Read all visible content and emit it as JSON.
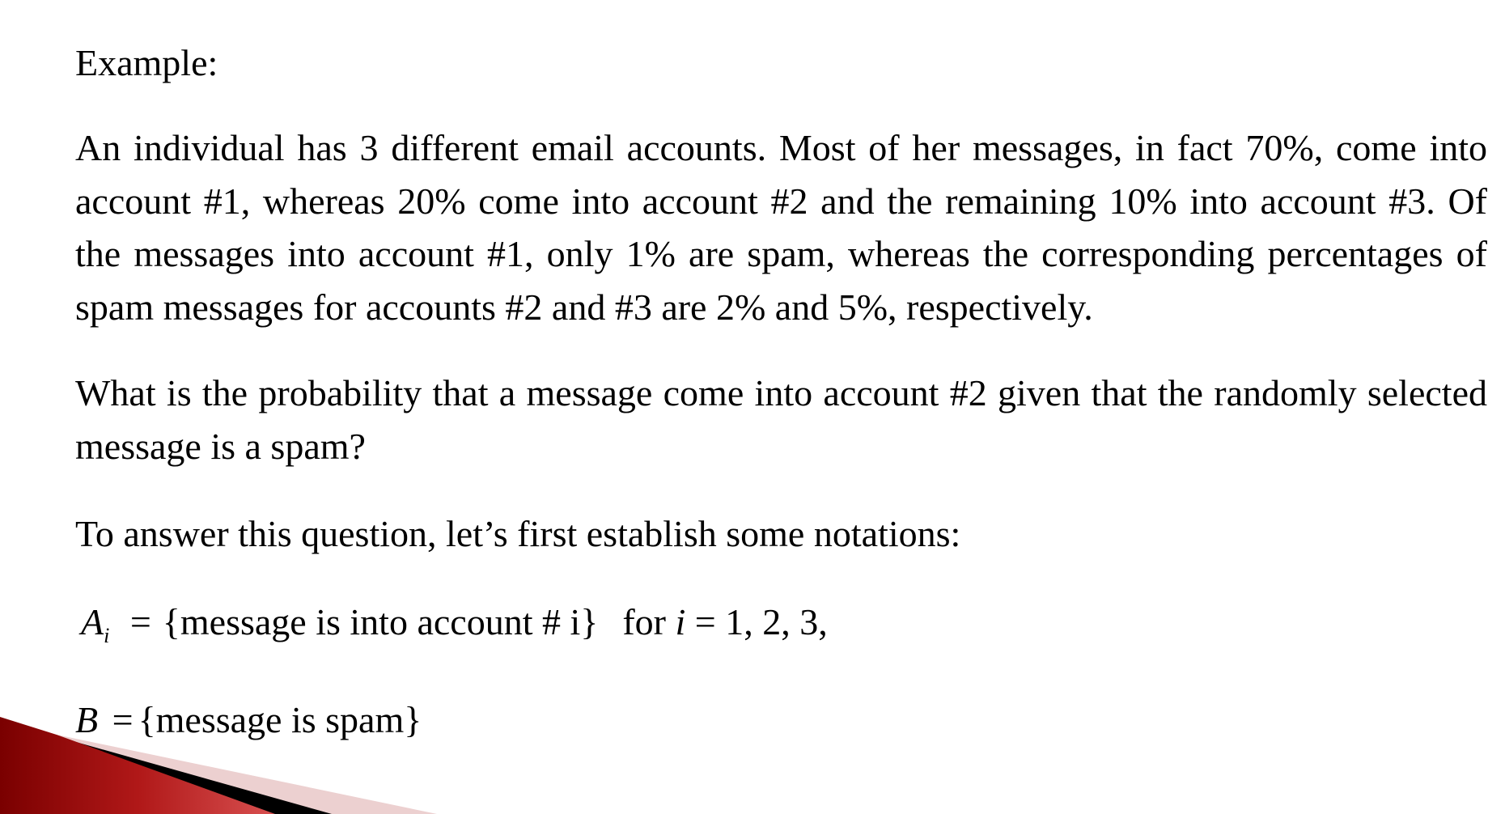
{
  "slide": {
    "heading": "Example:",
    "paragraphs": [
      "An individual has 3 different email accounts. Most of her messages, in fact 70%, come into account #1, whereas 20% come into account #2 and the remaining 10% into account #3. Of the messages into account #1, only 1% are spam, whereas the corresponding percentages of spam messages for accounts #2 and #3 are 2% and 5%, respectively.",
      "What is the probability that a message come into account #2 given that the randomly selected message is a spam?",
      "To answer this question, let’s first establish some notations:"
    ],
    "formula_a": {
      "symbol": "A",
      "subscript": "i",
      "equals": "=",
      "set": "{message is into account # i}",
      "qualifier_prefix": "for",
      "qualifier_var": "i",
      "qualifier_rest": "= 1, 2, 3,"
    },
    "formula_b": {
      "symbol": "B",
      "equals": "=",
      "set": "{message is spam}"
    }
  },
  "theme": {
    "accent_red": "#b01010",
    "accent_dark": "#000000",
    "accent_light": "#e8c8c8"
  }
}
